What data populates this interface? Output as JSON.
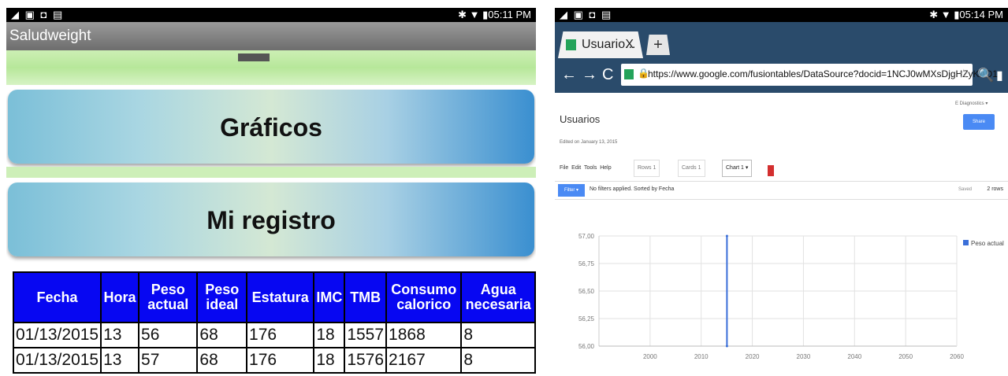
{
  "left": {
    "status": {
      "left_icons": "◢ ▣ ◘ ▤",
      "right": "✱ ▼ ▮05:11 PM"
    },
    "app_title": "Saludweight",
    "buttons": {
      "graficos": "Gráficos",
      "registro": "Mi registro"
    },
    "table": {
      "headers": [
        "Fecha",
        "Hora",
        "Peso actual",
        "Peso ideal",
        "Estatura",
        "IMC",
        "TMB",
        "Consumo calorico",
        "Agua necesaria"
      ],
      "rows": [
        [
          "01/13/2015",
          "13",
          "56",
          "68",
          "176",
          "18",
          "1557",
          "1868",
          "8"
        ],
        [
          "01/13/2015",
          "13",
          "57",
          "68",
          "176",
          "18",
          "1576",
          "2167",
          "8"
        ]
      ]
    }
  },
  "right": {
    "status": {
      "left_icons": "◢ ▣ ◘ ▤",
      "right": "✱ ▼ ▮05:14 PM"
    },
    "tab": {
      "label": "Usuario...",
      "close": "X",
      "new_tab": "+"
    },
    "nav": {
      "back": "←",
      "forward": "→",
      "reload": "C",
      "search": "🔍",
      "bookmarks": "▮"
    },
    "url": "https://www.google.com/fusiontables/DataSource?docid=1NCJ0wMXsDjgHZyKAD1",
    "page_title": "Usuarios",
    "edited": "Edited on January 13, 2015",
    "user": "E Diagnostics ▾",
    "share": "Share",
    "menu": [
      "File",
      "Edit",
      "Tools",
      "Help"
    ],
    "sheet_tabs": [
      "Rows 1",
      "Cards 1",
      "Chart 1 ▾"
    ],
    "filter": {
      "button": "Filter ▾",
      "text": "No filters applied. Sorted by Fecha",
      "saved": "Saved",
      "rows": "2 rows"
    },
    "colors": {
      "chrome": "#2a4b6b",
      "accent": "#4a8af4",
      "series": "#3b6fd9"
    }
  },
  "chart_data": {
    "type": "scatter",
    "title": "",
    "xlabel": "",
    "ylabel": "",
    "series": [
      {
        "name": "Peso actual",
        "x": [
          2015.04,
          2015.04
        ],
        "y": [
          56,
          57
        ]
      }
    ],
    "xlim": [
      1990,
      2060
    ],
    "ylim": [
      56,
      57
    ],
    "xticks": [
      "2000",
      "2010",
      "2020",
      "2030",
      "2040",
      "2050",
      "2060"
    ],
    "yticks": [
      "57,00",
      "56,75",
      "56,50",
      "56,25",
      "56,00"
    ],
    "legend": "right",
    "grid": true
  }
}
